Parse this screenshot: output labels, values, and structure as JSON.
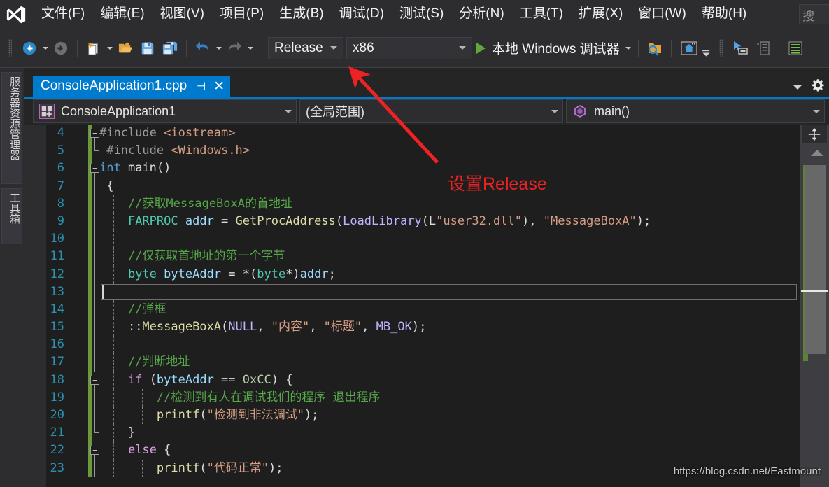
{
  "app": {
    "logo_icon": "visual-studio-logo-icon"
  },
  "menubar": {
    "items": [
      {
        "label": "文件(F)"
      },
      {
        "label": "编辑(E)"
      },
      {
        "label": "视图(V)"
      },
      {
        "label": "项目(P)"
      },
      {
        "label": "生成(B)"
      },
      {
        "label": "调试(D)"
      },
      {
        "label": "测试(S)"
      },
      {
        "label": "分析(N)"
      },
      {
        "label": "工具(T)"
      },
      {
        "label": "扩展(X)"
      },
      {
        "label": "窗口(W)"
      },
      {
        "label": "帮助(H)"
      }
    ],
    "search_text": "搜"
  },
  "toolbar": {
    "nav_back_icon": "navigate-back-icon",
    "nav_forward_icon": "navigate-forward-icon",
    "new_item_icon": "new-item-icon",
    "open_file_icon": "open-file-icon",
    "save_icon": "save-icon",
    "save_all_icon": "save-all-icon",
    "undo_icon": "undo-icon",
    "redo_icon": "redo-icon",
    "configuration": "Release",
    "platform": "x86",
    "run_label": "本地 Windows 调试器",
    "run_icon": "play-icon",
    "find_in_folder_icon": "find-in-files-icon",
    "home_icon": "home-icon",
    "select_element_icon": "select-element-icon",
    "copy_layout_icon": "copy-layout-icon",
    "list_icon": "properties-list-icon"
  },
  "leftdock": {
    "tabs": [
      {
        "label": "服务器资源管理器"
      },
      {
        "label": "工具箱"
      }
    ]
  },
  "editor": {
    "tab": {
      "title": "ConsoleApplication1.cpp",
      "pin_icon": "pin-icon",
      "close_icon": "close-icon"
    },
    "tab_dropdown_icon": "chevron-down-icon",
    "tab_settings_icon": "gear-icon",
    "navbar": {
      "project": "ConsoleApplication1",
      "project_icon": "project-icon",
      "scope": "(全局范围)",
      "member": "main()",
      "member_icon": "method-icon"
    },
    "scrollbar": {
      "split_icon": "split-view-icon",
      "up_arrow_icon": "scroll-up-icon"
    }
  },
  "code": {
    "first_line_number": 4,
    "lines": [
      {
        "num": 4,
        "fold": "minus",
        "tokens": [
          {
            "t": "#include ",
            "c": "c-pre"
          },
          {
            "t": "<iostream>",
            "c": "c-inc"
          }
        ]
      },
      {
        "num": 5,
        "vline_end": true,
        "tokens": [
          {
            "t": " #include ",
            "c": "c-pre"
          },
          {
            "t": "<Windows.h>",
            "c": "c-inc"
          }
        ]
      },
      {
        "num": 6,
        "fold": "minus",
        "tokens": [
          {
            "t": "int",
            "c": "c-kw"
          },
          {
            "t": " ",
            "c": "c-plain"
          },
          {
            "t": "main",
            "c": "c-plain"
          },
          {
            "t": "()",
            "c": "c-punc"
          }
        ]
      },
      {
        "num": 7,
        "vline": true,
        "tokens": [
          {
            "t": " {",
            "c": "c-punc"
          }
        ]
      },
      {
        "num": 8,
        "vline": true,
        "guide": true,
        "tokens": [
          {
            "t": "    //获取MessageBoxA的首地址",
            "c": "c-cmt"
          }
        ]
      },
      {
        "num": 9,
        "vline": true,
        "guide": true,
        "tokens": [
          {
            "t": "    ",
            "c": "c-plain"
          },
          {
            "t": "FARPROC",
            "c": "c-type"
          },
          {
            "t": " ",
            "c": "c-plain"
          },
          {
            "t": "addr",
            "c": "c-var"
          },
          {
            "t": " = ",
            "c": "c-punc"
          },
          {
            "t": "GetProcAddress",
            "c": "c-fn"
          },
          {
            "t": "(",
            "c": "c-punc"
          },
          {
            "t": "LoadLibrary",
            "c": "c-mac"
          },
          {
            "t": "(",
            "c": "c-punc"
          },
          {
            "t": "L",
            "c": "c-plain"
          },
          {
            "t": "\"user32.dll\"",
            "c": "c-str"
          },
          {
            "t": "), ",
            "c": "c-punc"
          },
          {
            "t": "\"MessageBoxA\"",
            "c": "c-str"
          },
          {
            "t": ");",
            "c": "c-punc"
          }
        ]
      },
      {
        "num": 10,
        "vline": true,
        "guide": true,
        "tokens": []
      },
      {
        "num": 11,
        "vline": true,
        "guide": true,
        "tokens": [
          {
            "t": "    //仅获取首地址的第一个字节",
            "c": "c-cmt"
          }
        ]
      },
      {
        "num": 12,
        "vline": true,
        "guide": true,
        "tokens": [
          {
            "t": "    ",
            "c": "c-plain"
          },
          {
            "t": "byte",
            "c": "c-type"
          },
          {
            "t": " ",
            "c": "c-plain"
          },
          {
            "t": "byteAddr",
            "c": "c-var"
          },
          {
            "t": " = *(",
            "c": "c-punc"
          },
          {
            "t": "byte",
            "c": "c-type"
          },
          {
            "t": "*)",
            "c": "c-punc"
          },
          {
            "t": "addr",
            "c": "c-var"
          },
          {
            "t": ";",
            "c": "c-punc"
          }
        ]
      },
      {
        "num": 13,
        "vline": true,
        "guide": true,
        "current": true,
        "tokens": []
      },
      {
        "num": 14,
        "vline": true,
        "guide": true,
        "tokens": [
          {
            "t": "    //弹框",
            "c": "c-cmt"
          }
        ]
      },
      {
        "num": 15,
        "vline": true,
        "guide": true,
        "tokens": [
          {
            "t": "    ::",
            "c": "c-punc"
          },
          {
            "t": "MessageBoxA",
            "c": "c-fn"
          },
          {
            "t": "(",
            "c": "c-punc"
          },
          {
            "t": "NULL",
            "c": "c-mac"
          },
          {
            "t": ", ",
            "c": "c-punc"
          },
          {
            "t": "\"内容\"",
            "c": "c-str"
          },
          {
            "t": ", ",
            "c": "c-punc"
          },
          {
            "t": "\"标题\"",
            "c": "c-str"
          },
          {
            "t": ", ",
            "c": "c-punc"
          },
          {
            "t": "MB_OK",
            "c": "c-mac"
          },
          {
            "t": ");",
            "c": "c-punc"
          }
        ]
      },
      {
        "num": 16,
        "vline": true,
        "guide": true,
        "tokens": []
      },
      {
        "num": 17,
        "vline": true,
        "guide": true,
        "tokens": [
          {
            "t": "    //判断地址",
            "c": "c-cmt"
          }
        ]
      },
      {
        "num": 18,
        "fold": "minus",
        "guide": true,
        "tokens": [
          {
            "t": "    ",
            "c": "c-plain"
          },
          {
            "t": "if",
            "c": "c-kw2"
          },
          {
            "t": " (",
            "c": "c-punc"
          },
          {
            "t": "byteAddr",
            "c": "c-var"
          },
          {
            "t": " == ",
            "c": "c-punc"
          },
          {
            "t": "0xCC",
            "c": "c-num"
          },
          {
            "t": ") {",
            "c": "c-punc"
          }
        ]
      },
      {
        "num": 19,
        "vline": true,
        "guide": true,
        "guide2": true,
        "tokens": [
          {
            "t": "        //检测到有人在调试我们的程序 退出程序",
            "c": "c-cmt"
          }
        ]
      },
      {
        "num": 20,
        "vline": true,
        "guide": true,
        "guide2": true,
        "tokens": [
          {
            "t": "        ",
            "c": "c-plain"
          },
          {
            "t": "printf",
            "c": "c-fn"
          },
          {
            "t": "(",
            "c": "c-punc"
          },
          {
            "t": "\"检测到非法调试\"",
            "c": "c-str"
          },
          {
            "t": ");",
            "c": "c-punc"
          }
        ]
      },
      {
        "num": 21,
        "vline_end": true,
        "guide": true,
        "tokens": [
          {
            "t": "    }",
            "c": "c-punc"
          }
        ]
      },
      {
        "num": 22,
        "fold": "minus",
        "guide": true,
        "tokens": [
          {
            "t": "    ",
            "c": "c-plain"
          },
          {
            "t": "else",
            "c": "c-kw2"
          },
          {
            "t": " {",
            "c": "c-punc"
          }
        ]
      },
      {
        "num": 23,
        "vline": true,
        "guide": true,
        "guide2": true,
        "tokens": [
          {
            "t": "        ",
            "c": "c-plain"
          },
          {
            "t": "printf",
            "c": "c-fn"
          },
          {
            "t": "(",
            "c": "c-punc"
          },
          {
            "t": "\"代码正常\"",
            "c": "c-str"
          },
          {
            "t": ");",
            "c": "c-punc"
          }
        ]
      }
    ]
  },
  "annotations": {
    "arrow_color": "#ee2222",
    "label": "设置Release",
    "watermark": "https://blog.csdn.net/Eastmount"
  }
}
